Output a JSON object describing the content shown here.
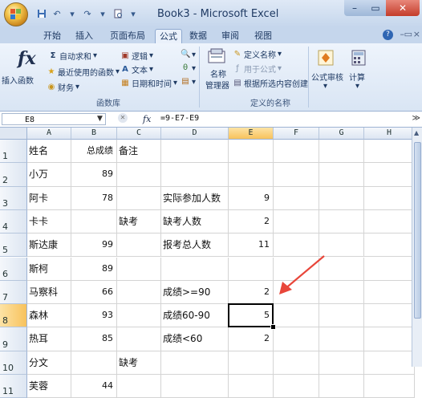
{
  "window": {
    "title": "Book3 - Microsoft Excel",
    "min_label": "–",
    "max_label": "▭",
    "close_label": "✕"
  },
  "tabs": [
    {
      "label": "开始"
    },
    {
      "label": "插入"
    },
    {
      "label": "页面布局"
    },
    {
      "label": "公式",
      "active": true
    },
    {
      "label": "数据"
    },
    {
      "label": "审阅"
    },
    {
      "label": "视图"
    }
  ],
  "ribbon": {
    "insert_function": "插入函数",
    "autosum": "自动求和",
    "recent": "最近使用的函数",
    "finance": "财务",
    "logical": "逻辑",
    "text": "文本",
    "datetime": "日期和时间",
    "name_manager_1": "名称",
    "name_manager_2": "管理器",
    "define_name": "定义名称",
    "use_in_formula": "用于公式",
    "create_from_selection": "根据所选内容创建",
    "formula_audit": "公式审核",
    "calculation": "计算",
    "group_function_library": "函数库",
    "group_defined_names": "定义的名称"
  },
  "formula_bar": {
    "name_box": "E8",
    "fx": "fx",
    "formula": "=9-E7-E9"
  },
  "columns": [
    "A",
    "B",
    "C",
    "D",
    "E",
    "F",
    "G",
    "H"
  ],
  "selected_column": "E",
  "rows": [
    {
      "n": "1",
      "A": "姓名",
      "B": "总成绩",
      "C": "备注",
      "D": "",
      "E": ""
    },
    {
      "n": "2",
      "A": "小万",
      "B": "89",
      "C": "",
      "D": "",
      "E": ""
    },
    {
      "n": "3",
      "A": "阿卡",
      "B": "78",
      "C": "",
      "D": "实际参加人数",
      "E": "9"
    },
    {
      "n": "4",
      "A": "卡卡",
      "B": "",
      "C": "缺考",
      "D": "缺考人数",
      "E": "2"
    },
    {
      "n": "5",
      "A": "斯达康",
      "B": "99",
      "C": "",
      "D": "报考总人数",
      "E": "11"
    },
    {
      "n": "6",
      "A": "斯柯",
      "B": "89",
      "C": "",
      "D": "",
      "E": ""
    },
    {
      "n": "7",
      "A": "马察科",
      "B": "66",
      "C": "",
      "D": "成绩>=90",
      "E": "2"
    },
    {
      "n": "8",
      "A": "森林",
      "B": "93",
      "C": "",
      "D": "成绩60-90",
      "E": "5"
    },
    {
      "n": "9",
      "A": "热耳",
      "B": "85",
      "C": "",
      "D": "成绩<60",
      "E": "2"
    },
    {
      "n": "10",
      "A": "分文",
      "B": "",
      "C": "缺考",
      "D": "",
      "E": ""
    },
    {
      "n": "11",
      "A": "芙蓉",
      "B": "44",
      "C": "",
      "D": "",
      "E": ""
    }
  ],
  "selected_row": "8",
  "annotation_color": "#e8463a"
}
